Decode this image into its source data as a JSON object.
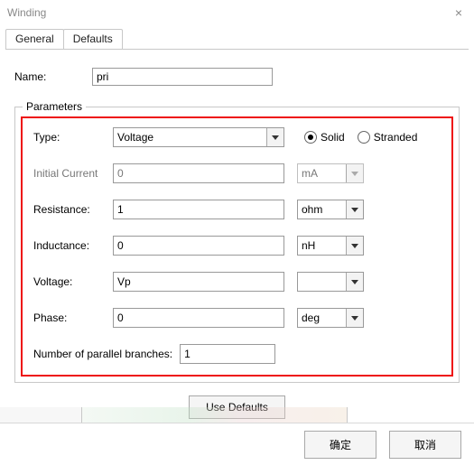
{
  "window": {
    "title": "Winding"
  },
  "tabs": {
    "general": "General",
    "defaults": "Defaults",
    "active": "general"
  },
  "name": {
    "label": "Name:",
    "value": "pri"
  },
  "params": {
    "legend": "Parameters",
    "type": {
      "label": "Type:",
      "value": "Voltage"
    },
    "solid": {
      "label": "Solid",
      "checked": true
    },
    "stranded": {
      "label": "Stranded",
      "checked": false
    },
    "initial_current": {
      "label": "Initial Current",
      "value": "0",
      "unit": "mA",
      "enabled": false
    },
    "resistance": {
      "label": "Resistance:",
      "value": "1",
      "unit": "ohm"
    },
    "inductance": {
      "label": "Inductance:",
      "value": "0",
      "unit": "nH"
    },
    "voltage": {
      "label": "Voltage:",
      "value": "Vp",
      "unit": ""
    },
    "phase": {
      "label": "Phase:",
      "value": "0",
      "unit": "deg"
    },
    "branches": {
      "label": "Number of parallel branches:",
      "value": "1"
    }
  },
  "buttons": {
    "use_defaults": "Use Defaults",
    "ok": "确定",
    "cancel": "取消"
  }
}
